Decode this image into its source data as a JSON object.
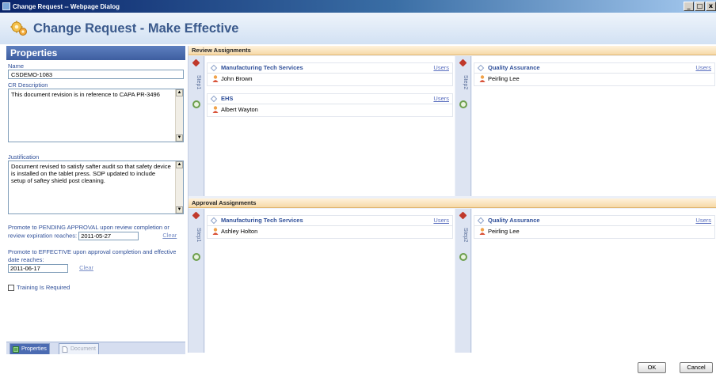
{
  "window": {
    "title": "Change Request -- Webpage Dialog",
    "controls": [
      "_",
      "□",
      "x"
    ]
  },
  "header": {
    "title": "Change Request - Make Effective"
  },
  "properties": {
    "title": "Properties",
    "name_label": "Name",
    "name_value": "CSDEMO-1083",
    "description_label": "CR Description",
    "description_value": "This document revision is in reference to CAPA PR-3496",
    "justification_label": "Justification",
    "justification_value": "Document revised to satisfy safter audit so that safety device is installed on the tablet press.  SOP updated to include setup of saftey shield post cleaning.",
    "promote_pending_text": "Promote to PENDING APPROVAL upon review completion or review expiration reaches:",
    "promote_pending_date": "2011-05-27",
    "promote_effective_text": "Promote to EFFECTIVE upon approval completion and effective date reaches:",
    "promote_effective_date": "2011-06-17",
    "clear_label": "Clear",
    "training_label": "Training Is Required"
  },
  "tabs": [
    {
      "label": "Properties",
      "active": true
    },
    {
      "label": "Document",
      "active": false
    }
  ],
  "review": {
    "title": "Review Assignments",
    "steps": [
      {
        "label": "Step1",
        "groups": [
          {
            "name": "Manufacturing Tech Services",
            "users_link": "Users",
            "members": [
              "John Brown"
            ]
          },
          {
            "name": "EHS",
            "users_link": "Users",
            "members": [
              "Albert Wayton"
            ]
          }
        ]
      },
      {
        "label": "Step2",
        "groups": [
          {
            "name": "Quality Assurance",
            "users_link": "Users",
            "members": [
              "Peirling Lee"
            ]
          }
        ]
      }
    ]
  },
  "approval": {
    "title": "Approval Assignments",
    "steps": [
      {
        "label": "Step1",
        "groups": [
          {
            "name": "Manufacturing Tech Services",
            "users_link": "Users",
            "members": [
              "Ashley Holton"
            ]
          }
        ]
      },
      {
        "label": "Step2",
        "groups": [
          {
            "name": "Quality Assurance",
            "users_link": "Users",
            "members": [
              "Peirling Lee"
            ]
          }
        ]
      }
    ]
  },
  "footer": {
    "ok_label": "OK",
    "cancel_label": "Cancel"
  },
  "colors": {
    "accent": "#3e5ea0",
    "section_header": "#f6d9a8",
    "link": "#5a6fbf"
  }
}
